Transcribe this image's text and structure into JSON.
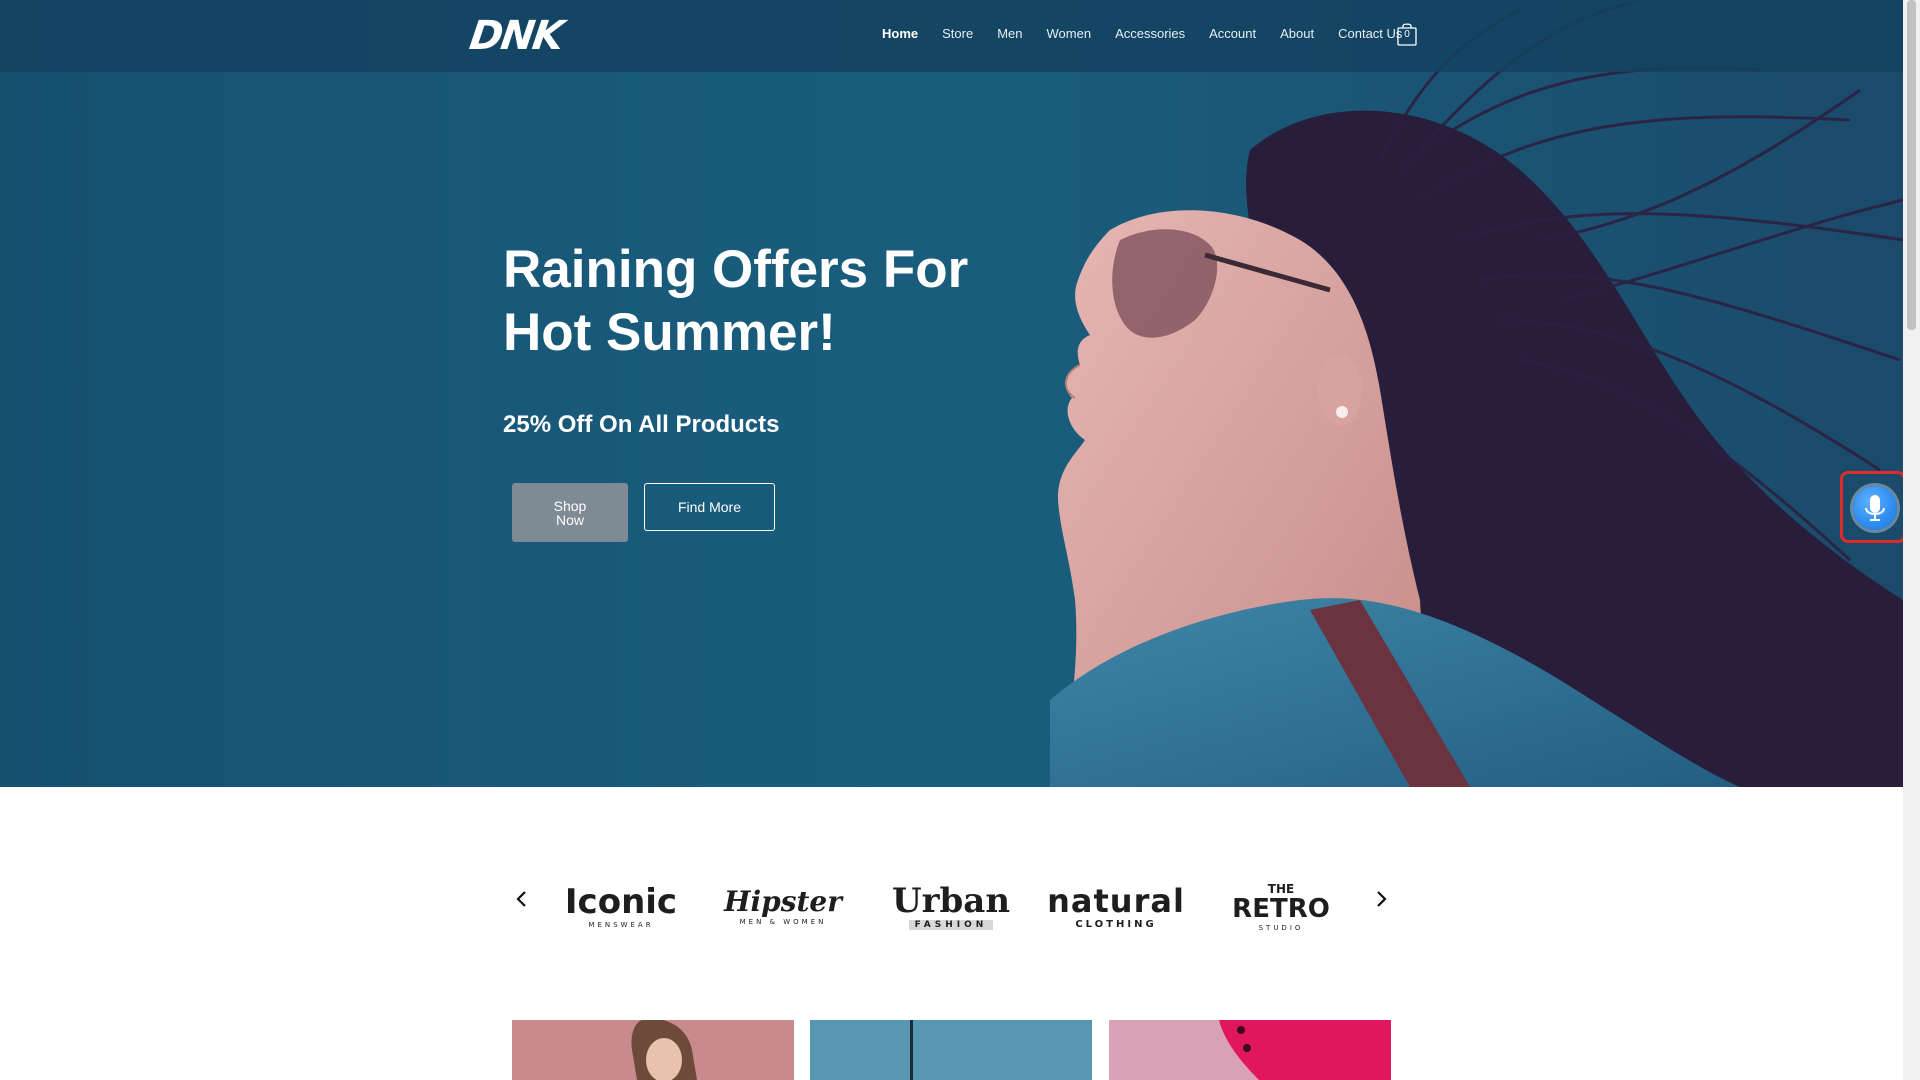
{
  "brand": {
    "logo_text": "DNK"
  },
  "nav": {
    "items": [
      {
        "label": "Home",
        "active": true
      },
      {
        "label": "Store",
        "active": false
      },
      {
        "label": "Men",
        "active": false
      },
      {
        "label": "Women",
        "active": false
      },
      {
        "label": "Accessories",
        "active": false
      },
      {
        "label": "Account",
        "active": false
      },
      {
        "label": "About",
        "active": false
      },
      {
        "label": "Contact Us",
        "active": false
      }
    ],
    "cart_count": "0",
    "cart_icon": "shopping-bag-icon"
  },
  "hero": {
    "title": "Raining Offers For Hot Summer!",
    "subtitle": "25% Off On All Products",
    "primary_button": "Shop Now",
    "secondary_button": "Find More"
  },
  "voice_widget": {
    "icon": "microphone-icon",
    "accent_color": "#2f8ff0",
    "highlight_color": "#e02b2b"
  },
  "brands_carousel": {
    "prev_icon": "chevron-left-icon",
    "next_icon": "chevron-right-icon",
    "logos": [
      {
        "name": "Iconic",
        "tagline": "MENSWEAR"
      },
      {
        "name": "Hipster",
        "tagline": "MEN & WOMEN"
      },
      {
        "name": "Urban",
        "tagline": "FASHION"
      },
      {
        "name": "natural",
        "tagline": "CLOTHING"
      },
      {
        "name": "RETRO",
        "prefix": "THE",
        "tagline": "STUDIO"
      }
    ]
  },
  "colors": {
    "hero_background": "#195b7b",
    "navbar": "#144260",
    "shop_button": "#7e8a94"
  }
}
